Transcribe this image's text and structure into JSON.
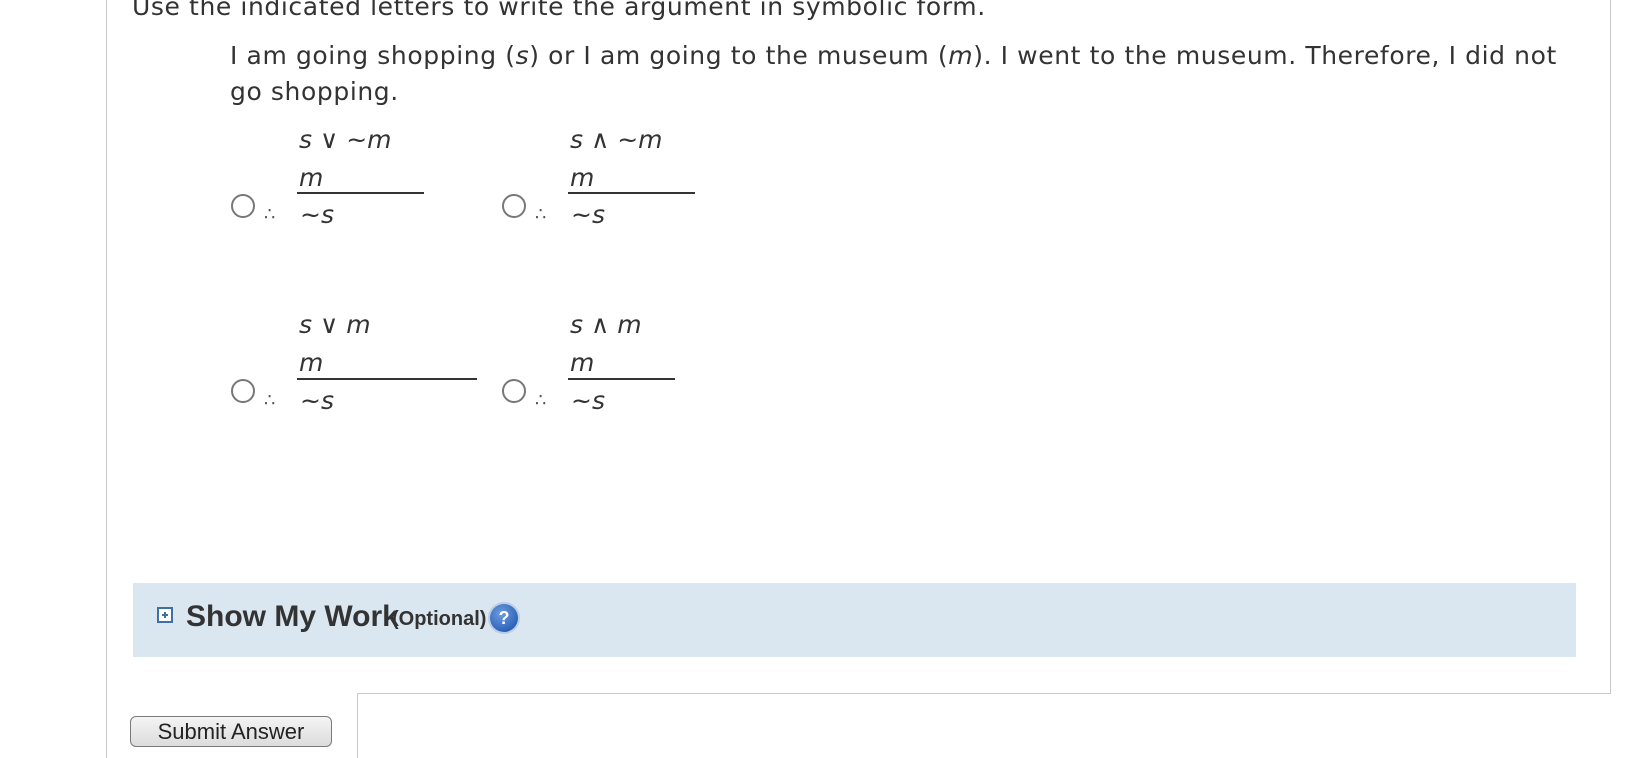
{
  "instruction": "Use the indicated letters to write the argument in symbolic form.",
  "question": {
    "part1": "I am going shopping (",
    "var_s": "s",
    "part2": ") or I am going to the museum (",
    "var_m": "m",
    "part3": "). I went to the museum. Therefore, I did not go shopping."
  },
  "options": [
    {
      "premise1": "s ∨ ~m",
      "premise2": "m",
      "therefore": "∴",
      "conclusion": "~s",
      "selected": false
    },
    {
      "premise1": "s ∧ ~m",
      "premise2": "m",
      "therefore": "∴",
      "conclusion": "~s",
      "selected": false
    },
    {
      "premise1": "s ∨ m",
      "premise2": "m",
      "therefore": "∴",
      "conclusion": "~s",
      "selected": false
    },
    {
      "premise1": "s ∧ m",
      "premise2": "m",
      "therefore": "∴",
      "conclusion": "~s",
      "selected": false
    }
  ],
  "show_my_work": {
    "title": "Show My Work",
    "optional": "(Optional)",
    "help_glyph": "?",
    "expand_icon": "plus-box-icon",
    "help_icon": "question-circle-icon"
  },
  "submit_label": "Submit Answer",
  "colors": {
    "show_work_bg": "#dae6f0",
    "help_icon": "#2f63b8",
    "text": "#333333"
  }
}
